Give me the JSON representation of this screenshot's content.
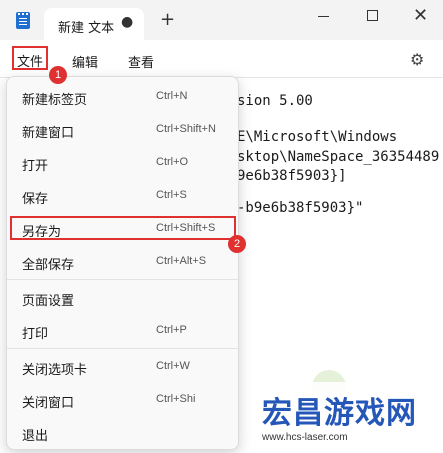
{
  "titlebar": {
    "tab_title": "新建 文本",
    "tab_modified": "●",
    "new_tab": "+",
    "minimize": "",
    "maximize": "",
    "close": "✕"
  },
  "menubar": {
    "file": "文件",
    "edit": "编辑",
    "view": "查看"
  },
  "annotations": {
    "badge1": "1",
    "badge2": "2",
    "accent_color": "#e03131"
  },
  "editor": {
    "lines": [
      "sion 5.00",
      "E\\Microsoft\\Windows",
      "sktop\\NameSpace_36354489",
      "9e6b38f5903}]",
      "-b9e6b38f5903}\""
    ]
  },
  "file_menu": {
    "items": [
      {
        "label": "新建标签页",
        "shortcut": "Ctrl+N"
      },
      {
        "label": "新建窗口",
        "shortcut": "Ctrl+Shift+N"
      },
      {
        "label": "打开",
        "shortcut": "Ctrl+O"
      },
      {
        "label": "保存",
        "shortcut": "Ctrl+S"
      },
      {
        "label": "另存为",
        "shortcut": "Ctrl+Shift+S"
      },
      {
        "label": "全部保存",
        "shortcut": "Ctrl+Alt+S"
      },
      {
        "label": "页面设置",
        "shortcut": ""
      },
      {
        "label": "打印",
        "shortcut": "Ctrl+P"
      },
      {
        "label": "关闭选项卡",
        "shortcut": "Ctrl+W"
      },
      {
        "label": "关闭窗口",
        "shortcut": "Ctrl+Shi"
      },
      {
        "label": "退出",
        "shortcut": ""
      }
    ]
  },
  "watermark": {
    "title": "宏昌游戏网",
    "url": "www.hcs-laser.com",
    "brand_color": "#2557b8"
  }
}
